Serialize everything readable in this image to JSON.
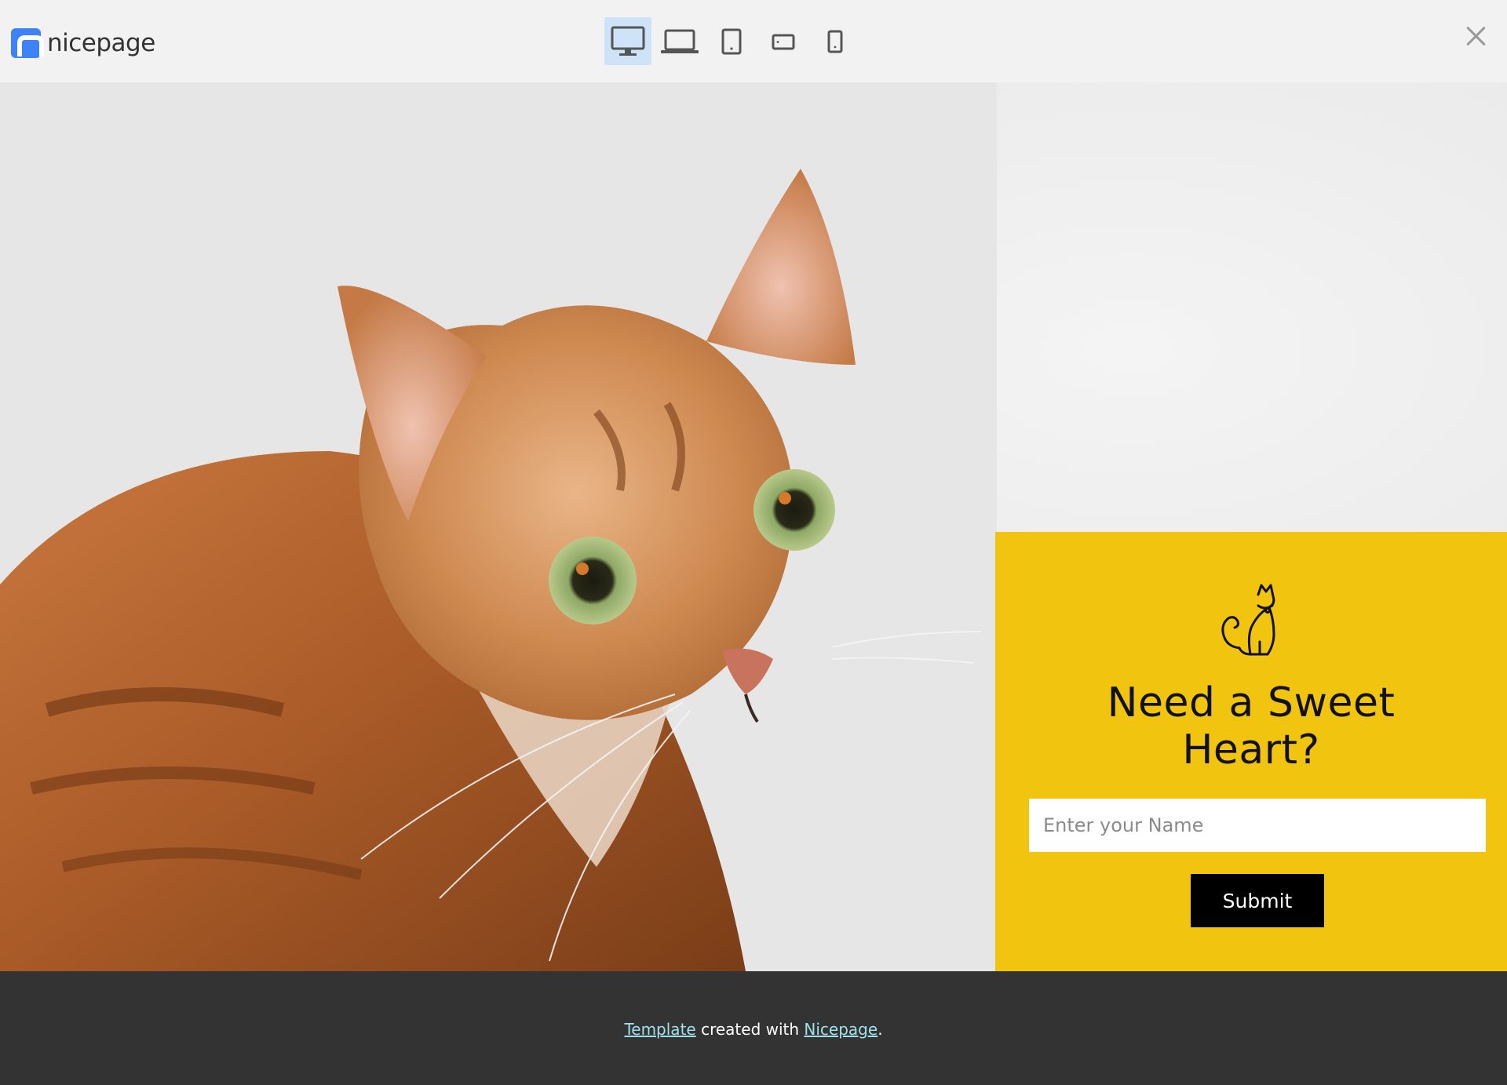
{
  "app": {
    "brand": "nicepage"
  },
  "toolbar": {
    "devices": [
      {
        "name": "desktop",
        "icon": "desktop-monitor-icon",
        "active": true
      },
      {
        "name": "laptop",
        "icon": "laptop-icon",
        "active": false
      },
      {
        "name": "tablet",
        "icon": "tablet-portrait-icon",
        "active": false
      },
      {
        "name": "phone-landscape",
        "icon": "phone-landscape-icon",
        "active": false
      },
      {
        "name": "phone",
        "icon": "phone-portrait-icon",
        "active": false
      }
    ],
    "close_icon": "close-icon"
  },
  "hero": {
    "image": "orange tabby cat photo",
    "card": {
      "icon": "cat-icon",
      "title_line1": "Need a Sweet",
      "title_line2": "Heart?",
      "input_placeholder": "Enter your Name",
      "input_value": "",
      "submit_label": "Submit",
      "background": "#f1c40f"
    }
  },
  "footer": {
    "link1": "Template",
    "middle": " created with ",
    "link2": "Nicepage",
    "end": ".",
    "background": "#333333",
    "link_color": "#9fe0e9"
  }
}
